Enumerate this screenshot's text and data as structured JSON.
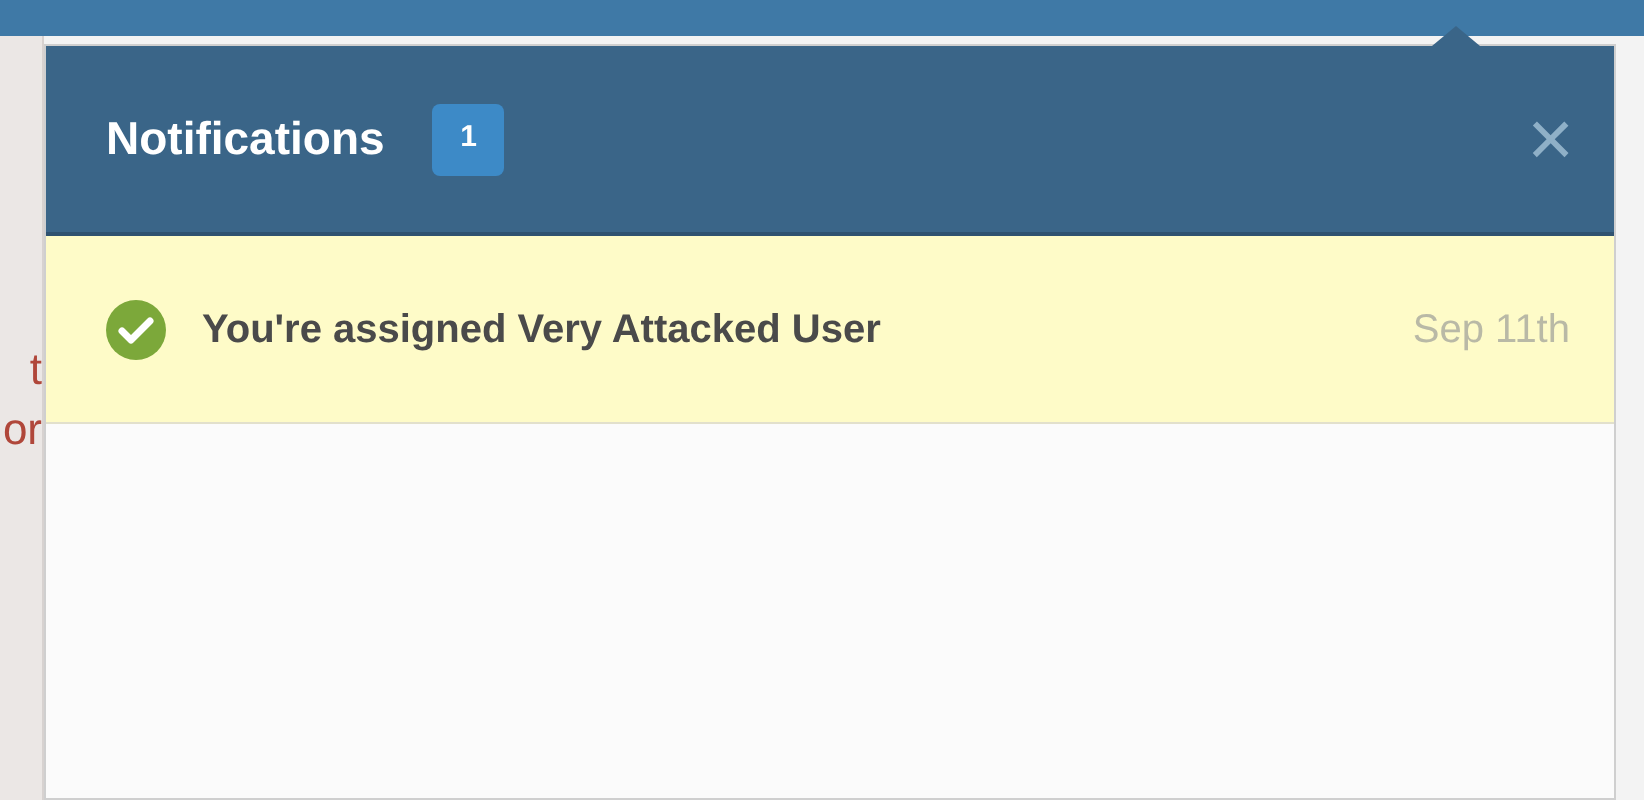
{
  "background_text": [
    "t",
    "or"
  ],
  "panel": {
    "title": "Notifications",
    "count": "1",
    "close": "×"
  },
  "notifications": [
    {
      "text": "You're assigned Very Attacked User",
      "date": "Sep 11th",
      "unread": true
    }
  ]
}
